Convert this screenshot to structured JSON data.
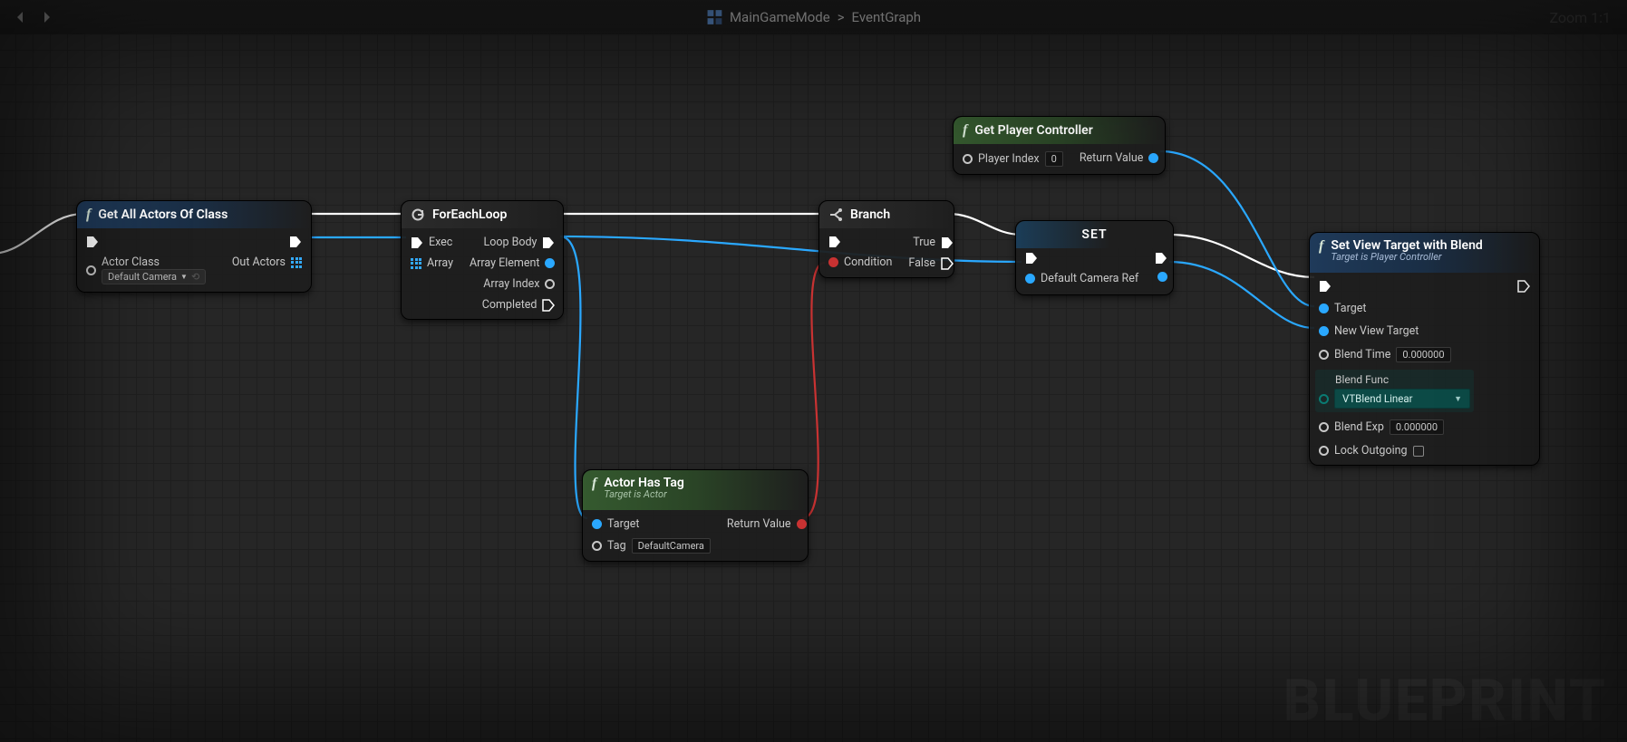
{
  "topbar": {
    "crumb_root": "MainGameMode",
    "crumb_leaf": "EventGraph",
    "zoom": "Zoom 1:1"
  },
  "watermark": "BLUEPRINT",
  "nodes": {
    "getAllActors": {
      "title": "Get All Actors Of Class",
      "in": {
        "actor_class": "Actor Class",
        "actor_class_val": "Default Camera"
      },
      "out": {
        "out_actors": "Out Actors"
      }
    },
    "forEach": {
      "title": "ForEachLoop",
      "in": {
        "exec": "Exec",
        "array": "Array"
      },
      "out": {
        "loop_body": "Loop Body",
        "array_element": "Array Element",
        "array_index": "Array Index",
        "completed": "Completed"
      }
    },
    "branch": {
      "title": "Branch",
      "in": {
        "condition": "Condition"
      },
      "out": {
        "true": "True",
        "false": "False"
      }
    },
    "set": {
      "title": "SET",
      "var": "Default Camera Ref"
    },
    "getPlayer": {
      "title": "Get Player Controller",
      "in": {
        "player_index": "Player Index",
        "player_index_val": "0"
      },
      "out": {
        "return": "Return Value"
      }
    },
    "actorHasTag": {
      "title": "Actor Has Tag",
      "subtitle": "Target is Actor",
      "in": {
        "target": "Target",
        "tag": "Tag",
        "tag_val": "DefaultCamera"
      },
      "out": {
        "return": "Return Value"
      }
    },
    "setViewTarget": {
      "title": "Set View Target with Blend",
      "subtitle": "Target is Player Controller",
      "in": {
        "target": "Target",
        "new_view_target": "New View Target",
        "blend_time": "Blend Time",
        "blend_time_val": "0.000000",
        "blend_func": "Blend Func",
        "blend_func_val": "VTBlend Linear",
        "blend_exp": "Blend Exp",
        "blend_exp_val": "0.000000",
        "lock_outgoing": "Lock Outgoing"
      }
    }
  }
}
